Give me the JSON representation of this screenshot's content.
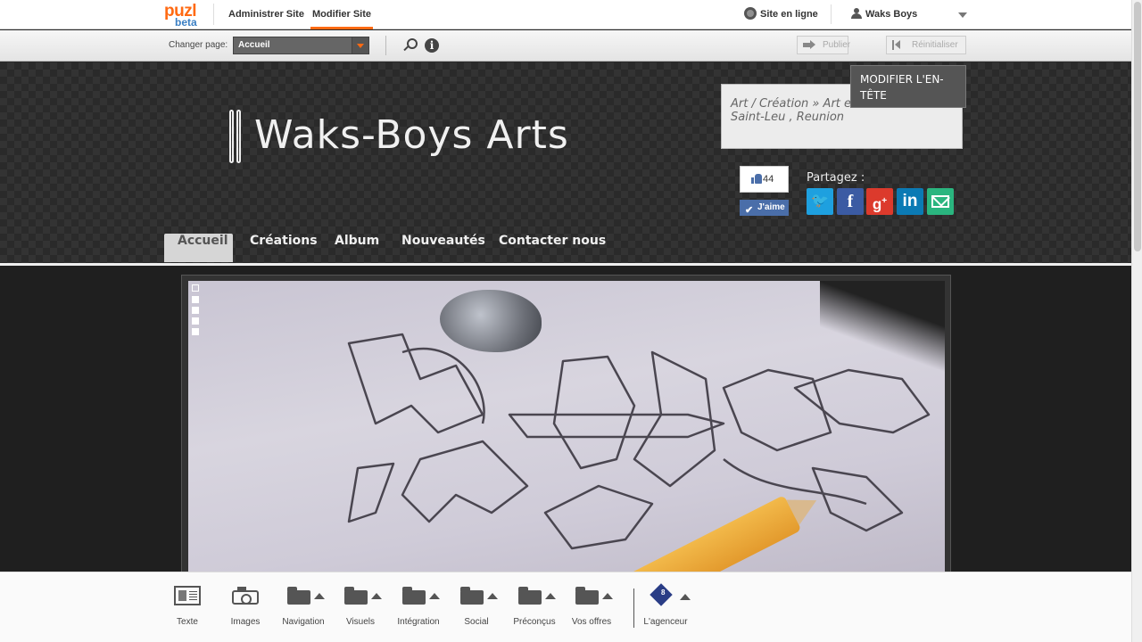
{
  "logo": {
    "line1": "puzl",
    "line2": "beta"
  },
  "admin_nav": {
    "administrer": "Administrer Site",
    "modifier": "Modifier Site",
    "site_online": "Site en ligne",
    "user_name": "Waks Boys"
  },
  "page_bar": {
    "change_label": "Changer page:",
    "selected_page": "Accueil",
    "publish_label": "Publier",
    "reset_label": "Réinitialiser"
  },
  "header": {
    "site_title": "Waks-Boys Arts",
    "info_category": "Art / Création » Art et dessin",
    "info_location": "Saint-Leu , Reunion",
    "edit_header_label": "Modifier l'en-tête",
    "like_count": "44",
    "like_label": "J'aime",
    "share_label": "Partagez :"
  },
  "share_icons": [
    "twitter-icon",
    "facebook-icon",
    "google-plus-icon",
    "linkedin-icon",
    "email-icon"
  ],
  "menu": [
    {
      "label": "Accueil",
      "active": true
    },
    {
      "label": "Créations"
    },
    {
      "label": "Album"
    },
    {
      "label": "Nouveautés"
    },
    {
      "label": "Contacter nous"
    }
  ],
  "slider": {
    "dot_count": 5,
    "active_dot": 1
  },
  "toolbar": {
    "items": [
      {
        "label": "Texte",
        "icon": "text-block-icon"
      },
      {
        "label": "Images",
        "icon": "camera-icon"
      },
      {
        "label": "Navigation",
        "icon": "folder-icon"
      },
      {
        "label": "Visuels",
        "icon": "folder-icon"
      },
      {
        "label": "Intégration",
        "icon": "folder-icon"
      },
      {
        "label": "Social",
        "icon": "folder-icon"
      },
      {
        "label": "Préconçus",
        "icon": "folder-icon"
      },
      {
        "label": "Vos offres",
        "icon": "folder-icon"
      }
    ],
    "agenceur_label": "L'agenceur",
    "agenceur_badge": "8"
  },
  "colors": {
    "accent": "#ff6a13",
    "header_bg": "#2a2a2a",
    "facebook": "#4a6ea9"
  }
}
